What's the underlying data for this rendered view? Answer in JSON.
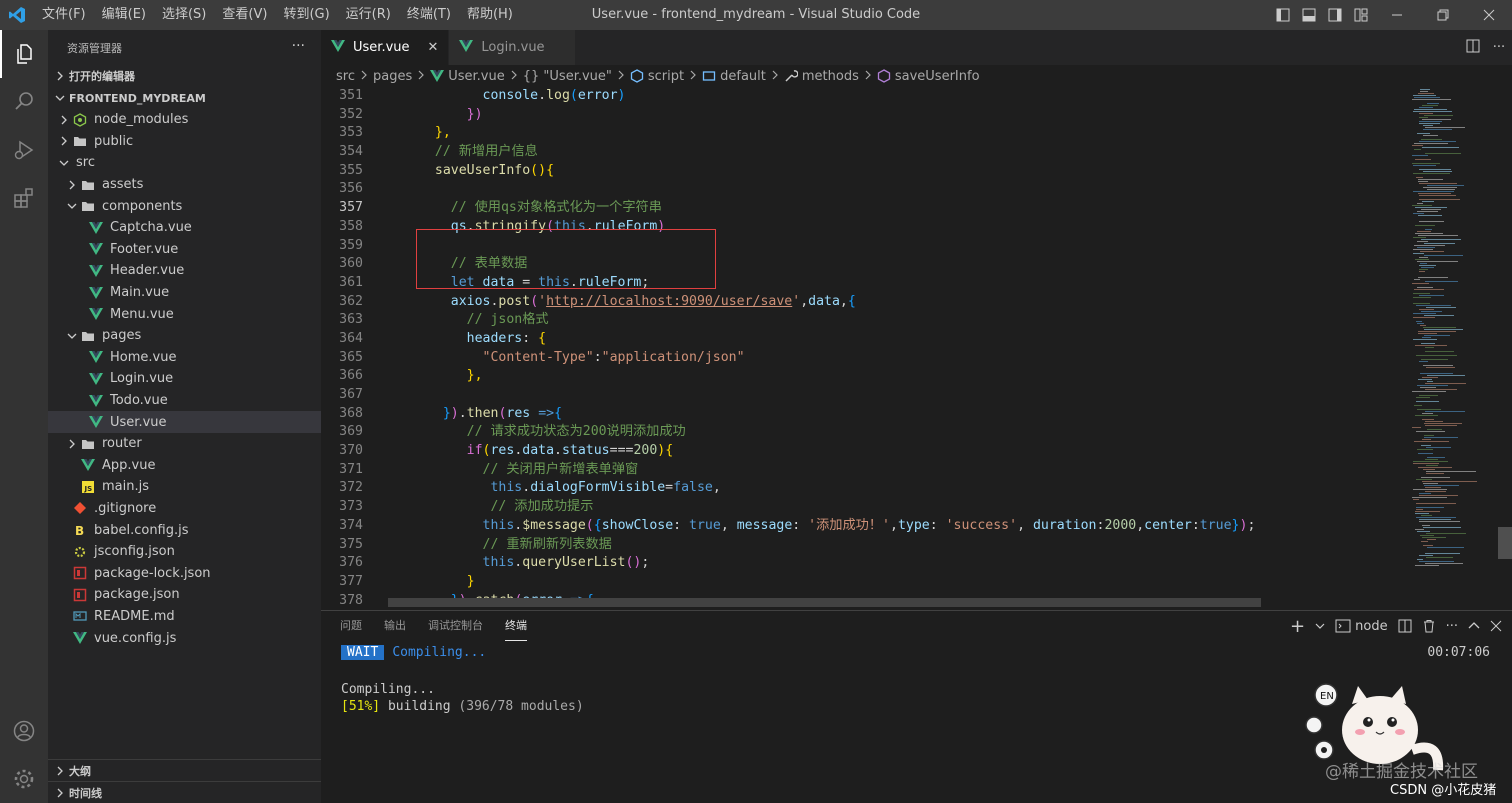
{
  "titlebar": {
    "menu": [
      "文件(F)",
      "编辑(E)",
      "选择(S)",
      "查看(V)",
      "转到(G)",
      "运行(R)",
      "终端(T)",
      "帮助(H)"
    ],
    "title": "User.vue - frontend_mydream - Visual Studio Code"
  },
  "sidebar": {
    "title": "资源管理器",
    "more": "···",
    "open_editors": "打开的编辑器",
    "project": "FRONTEND_MYDREAM",
    "tree": [
      {
        "label": "node_modules",
        "depth": 1,
        "kind": "folder-collapsed",
        "icon": "node"
      },
      {
        "label": "public",
        "depth": 1,
        "kind": "folder-collapsed",
        "icon": "folder"
      },
      {
        "label": "src",
        "depth": 1,
        "kind": "folder-open",
        "icon": "none"
      },
      {
        "label": "assets",
        "depth": 2,
        "kind": "folder-collapsed",
        "icon": "folder"
      },
      {
        "label": "components",
        "depth": 2,
        "kind": "folder-open",
        "icon": "folder"
      },
      {
        "label": "Captcha.vue",
        "depth": 3,
        "kind": "file",
        "icon": "vue"
      },
      {
        "label": "Footer.vue",
        "depth": 3,
        "kind": "file",
        "icon": "vue"
      },
      {
        "label": "Header.vue",
        "depth": 3,
        "kind": "file",
        "icon": "vue"
      },
      {
        "label": "Main.vue",
        "depth": 3,
        "kind": "file",
        "icon": "vue"
      },
      {
        "label": "Menu.vue",
        "depth": 3,
        "kind": "file",
        "icon": "vue"
      },
      {
        "label": "pages",
        "depth": 2,
        "kind": "folder-open",
        "icon": "folder"
      },
      {
        "label": "Home.vue",
        "depth": 3,
        "kind": "file",
        "icon": "vue"
      },
      {
        "label": "Login.vue",
        "depth": 3,
        "kind": "file",
        "icon": "vue"
      },
      {
        "label": "Todo.vue",
        "depth": 3,
        "kind": "file",
        "icon": "vue"
      },
      {
        "label": "User.vue",
        "depth": 3,
        "kind": "file",
        "icon": "vue",
        "selected": true
      },
      {
        "label": "router",
        "depth": 2,
        "kind": "folder-collapsed",
        "icon": "folder"
      },
      {
        "label": "App.vue",
        "depth": 2,
        "kind": "file",
        "icon": "vue"
      },
      {
        "label": "main.js",
        "depth": 2,
        "kind": "file",
        "icon": "js"
      },
      {
        "label": ".gitignore",
        "depth": 1,
        "kind": "file",
        "icon": "git"
      },
      {
        "label": "babel.config.js",
        "depth": 1,
        "kind": "file",
        "icon": "babel"
      },
      {
        "label": "jsconfig.json",
        "depth": 1,
        "kind": "file",
        "icon": "config"
      },
      {
        "label": "package-lock.json",
        "depth": 1,
        "kind": "file",
        "icon": "npm"
      },
      {
        "label": "package.json",
        "depth": 1,
        "kind": "file",
        "icon": "npm"
      },
      {
        "label": "README.md",
        "depth": 1,
        "kind": "file",
        "icon": "md"
      },
      {
        "label": "vue.config.js",
        "depth": 1,
        "kind": "file",
        "icon": "vue"
      }
    ],
    "outline": "大纲",
    "timeline": "时间线"
  },
  "tabs": [
    {
      "label": "User.vue",
      "active": true,
      "close": "✕"
    },
    {
      "label": "Login.vue",
      "active": false
    }
  ],
  "breadcrumb": [
    "src",
    "pages",
    "User.vue",
    "{} \"User.vue\"",
    "script",
    "default",
    "methods",
    "saveUserInfo"
  ],
  "code": {
    "current_line": 357,
    "lines": [
      {
        "n": 351,
        "tokens": [
          [
            "        ",
            ""
          ],
          [
            "console",
            "vr"
          ],
          [
            ".",
            ""
          ],
          [
            "log",
            "fn"
          ],
          [
            "(",
            "br2"
          ],
          [
            "error",
            "vr"
          ],
          [
            ")",
            "br2"
          ]
        ]
      },
      {
        "n": 352,
        "tokens": [
          [
            "      ",
            ""
          ],
          [
            "})",
            "br1"
          ]
        ]
      },
      {
        "n": 353,
        "tokens": [
          [
            "  ",
            ""
          ],
          [
            "},",
            "br3"
          ]
        ]
      },
      {
        "n": 354,
        "tokens": [
          [
            "  ",
            ""
          ],
          [
            "// 新增用户信息",
            "cm"
          ]
        ]
      },
      {
        "n": 355,
        "tokens": [
          [
            "  ",
            ""
          ],
          [
            "saveUserInfo",
            "fn"
          ],
          [
            "()",
            "br3"
          ],
          [
            "{",
            "br3"
          ]
        ]
      },
      {
        "n": 356,
        "tokens": [
          [
            "",
            ""
          ]
        ]
      },
      {
        "n": 357,
        "tokens": [
          [
            "    ",
            ""
          ],
          [
            "// 使用qs对象格式化为一个字符串",
            "cm"
          ]
        ]
      },
      {
        "n": 358,
        "tokens": [
          [
            "    ",
            ""
          ],
          [
            "qs",
            "vr"
          ],
          [
            ".",
            ""
          ],
          [
            "stringify",
            "fn"
          ],
          [
            "(",
            "br1"
          ],
          [
            "this",
            "kw"
          ],
          [
            ".",
            ""
          ],
          [
            "ruleForm",
            "vr"
          ],
          [
            ")",
            "br1"
          ]
        ]
      },
      {
        "n": 359,
        "tokens": [
          [
            "",
            ""
          ]
        ]
      },
      {
        "n": 360,
        "tokens": [
          [
            "    ",
            ""
          ],
          [
            "// 表单数据",
            "cm"
          ]
        ]
      },
      {
        "n": 361,
        "tokens": [
          [
            "    ",
            ""
          ],
          [
            "let",
            "kw"
          ],
          [
            " ",
            ""
          ],
          [
            "data",
            "vr"
          ],
          [
            " = ",
            ""
          ],
          [
            "this",
            "kw"
          ],
          [
            ".",
            ""
          ],
          [
            "ruleForm",
            "vr"
          ],
          [
            ";",
            ""
          ]
        ]
      },
      {
        "n": 362,
        "tokens": [
          [
            "    ",
            ""
          ],
          [
            "axios",
            "vr"
          ],
          [
            ".",
            ""
          ],
          [
            "post",
            "fn"
          ],
          [
            "(",
            "br1"
          ],
          [
            "'",
            "str"
          ],
          [
            "http://localhost:9090/user/save",
            "url"
          ],
          [
            "'",
            "str"
          ],
          [
            ",",
            ""
          ],
          [
            "data",
            "vr"
          ],
          [
            ",",
            ""
          ],
          [
            "{",
            "br2"
          ]
        ]
      },
      {
        "n": 363,
        "tokens": [
          [
            "      ",
            ""
          ],
          [
            "// json格式",
            "cm"
          ]
        ]
      },
      {
        "n": 364,
        "tokens": [
          [
            "      ",
            ""
          ],
          [
            "headers",
            "vr"
          ],
          [
            ": ",
            ""
          ],
          [
            "{",
            "br3"
          ]
        ]
      },
      {
        "n": 365,
        "tokens": [
          [
            "        ",
            ""
          ],
          [
            "\"Content-Type\"",
            "str"
          ],
          [
            ":",
            ""
          ],
          [
            "\"application/json\"",
            "str"
          ]
        ]
      },
      {
        "n": 366,
        "tokens": [
          [
            "      ",
            ""
          ],
          [
            "},",
            "br3"
          ]
        ]
      },
      {
        "n": 367,
        "tokens": [
          [
            "",
            ""
          ]
        ]
      },
      {
        "n": 368,
        "tokens": [
          [
            "   ",
            ""
          ],
          [
            "}",
            "br2"
          ],
          [
            ")",
            "br1"
          ],
          [
            ".",
            ""
          ],
          [
            "then",
            "fn"
          ],
          [
            "(",
            "br1"
          ],
          [
            "res",
            "vr"
          ],
          [
            " ",
            ""
          ],
          [
            "=>",
            "kw"
          ],
          [
            "{",
            "br2"
          ]
        ]
      },
      {
        "n": 369,
        "tokens": [
          [
            "      ",
            ""
          ],
          [
            "// 请求成功状态为200说明添加成功",
            "cm"
          ]
        ]
      },
      {
        "n": 370,
        "tokens": [
          [
            "      ",
            ""
          ],
          [
            "if",
            "br1"
          ],
          [
            "(",
            "br3"
          ],
          [
            "res",
            "vr"
          ],
          [
            ".",
            ""
          ],
          [
            "data",
            "vr"
          ],
          [
            ".",
            ""
          ],
          [
            "status",
            "vr"
          ],
          [
            "===",
            ""
          ],
          [
            "200",
            "num"
          ],
          [
            ")",
            "br3"
          ],
          [
            "{",
            "br3"
          ]
        ]
      },
      {
        "n": 371,
        "tokens": [
          [
            "        ",
            ""
          ],
          [
            "// 关闭用户新增表单弹窗",
            "cm"
          ]
        ]
      },
      {
        "n": 372,
        "tokens": [
          [
            "         ",
            ""
          ],
          [
            "this",
            "kw"
          ],
          [
            ".",
            ""
          ],
          [
            "dialogFormVisible",
            "vr"
          ],
          [
            "=",
            ""
          ],
          [
            "false",
            "kw"
          ],
          [
            ",",
            ""
          ]
        ]
      },
      {
        "n": 373,
        "tokens": [
          [
            "         ",
            ""
          ],
          [
            "// 添加成功提示",
            "cm"
          ]
        ]
      },
      {
        "n": 374,
        "tokens": [
          [
            "        ",
            ""
          ],
          [
            "this",
            "kw"
          ],
          [
            ".",
            ""
          ],
          [
            "$message",
            "fn"
          ],
          [
            "(",
            "br1"
          ],
          [
            "{",
            "br2"
          ],
          [
            "showClose",
            "vr"
          ],
          [
            ": ",
            ""
          ],
          [
            "true",
            "kw"
          ],
          [
            ", ",
            ""
          ],
          [
            "message",
            "vr"
          ],
          [
            ": ",
            ""
          ],
          [
            "'添加成功！'",
            "str"
          ],
          [
            ",",
            ""
          ],
          [
            "type",
            "vr"
          ],
          [
            ": ",
            ""
          ],
          [
            "'success'",
            "str"
          ],
          [
            ", ",
            ""
          ],
          [
            "duration",
            "vr"
          ],
          [
            ":",
            ""
          ],
          [
            "2000",
            "num"
          ],
          [
            ",",
            ""
          ],
          [
            "center",
            "vr"
          ],
          [
            ":",
            ""
          ],
          [
            "true",
            "kw"
          ],
          [
            "}",
            "br2"
          ],
          [
            ")",
            "br1"
          ],
          [
            ";",
            ""
          ]
        ]
      },
      {
        "n": 375,
        "tokens": [
          [
            "        ",
            ""
          ],
          [
            "// 重新刷新列表数据",
            "cm"
          ]
        ]
      },
      {
        "n": 376,
        "tokens": [
          [
            "        ",
            ""
          ],
          [
            "this",
            "kw"
          ],
          [
            ".",
            ""
          ],
          [
            "queryUserList",
            "fn"
          ],
          [
            "()",
            "br1"
          ],
          [
            ";",
            ""
          ]
        ]
      },
      {
        "n": 377,
        "tokens": [
          [
            "      ",
            ""
          ],
          [
            "}",
            "br3"
          ]
        ]
      },
      {
        "n": 378,
        "tokens": [
          [
            "    ",
            ""
          ],
          [
            "}",
            "br2"
          ],
          [
            ")",
            "br1"
          ],
          [
            ".",
            ""
          ],
          [
            "catch",
            "fn"
          ],
          [
            "(",
            "br1"
          ],
          [
            "error",
            "vr"
          ],
          [
            " ",
            ""
          ],
          [
            "=>",
            "kw"
          ],
          [
            "{",
            "br2"
          ]
        ]
      }
    ]
  },
  "panel": {
    "tabs": [
      "问题",
      "输出",
      "调试控制台",
      "终端"
    ],
    "active_tab": "终端",
    "terminal_name": "node",
    "time": "00:07:06",
    "wait_badge": "WAIT",
    "wait_text": "Compiling...",
    "compiling": "Compiling...",
    "progress": "[51%]",
    "building_word": "building",
    "building_rest": "(396/78 modules)"
  },
  "watermark": {
    "text": "@稀土掘金技术社区",
    "csdn": "CSDN @小花皮猪"
  },
  "colors": {
    "accent_vue": "#41b883",
    "highlight_box": "#e04040"
  }
}
